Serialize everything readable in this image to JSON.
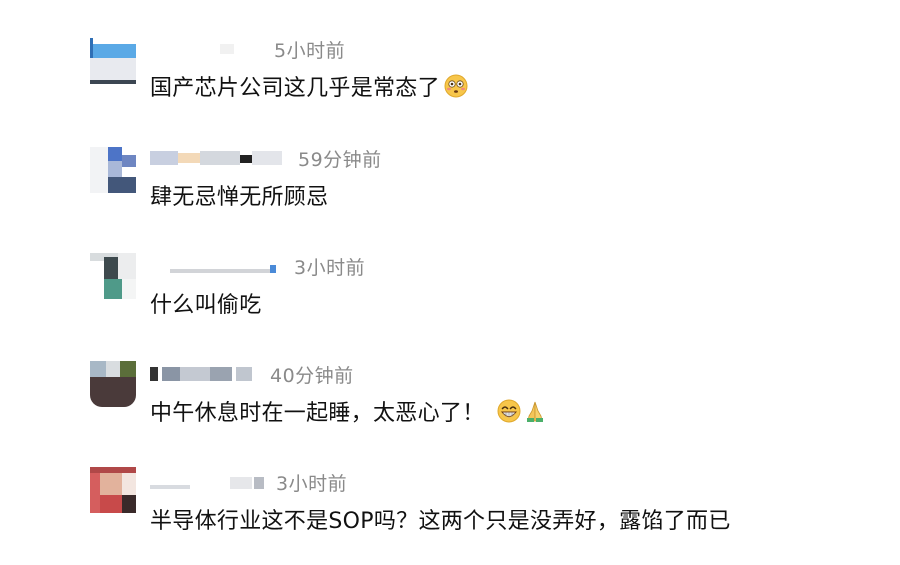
{
  "comments": [
    {
      "time": "5小时前",
      "text": "国产芯片公司这几乎是常态了",
      "emojis": [
        "flushed-face"
      ]
    },
    {
      "time": "59分钟前",
      "text": "肆无忌惮无所顾忌",
      "emojis": []
    },
    {
      "time": "3小时前",
      "text": "什么叫偷吃",
      "emojis": []
    },
    {
      "time": "40分钟前",
      "text": "中午休息时在一起睡，太恶心了！",
      "emojis": [
        "grinning-face",
        "folded-hands"
      ]
    },
    {
      "time": "3小时前",
      "text": "半导体行业这不是SOP吗？这两个只是没弄好，露馅了而已",
      "emojis": []
    }
  ]
}
